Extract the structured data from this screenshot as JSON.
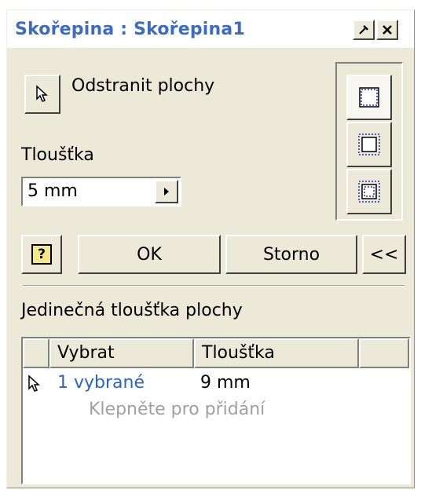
{
  "window": {
    "title": "Skořepina : Skořepina1",
    "buttons": [
      "pin-icon",
      "close-icon"
    ]
  },
  "remove_faces": {
    "label": "Odstranit plochy",
    "icon": "cursor-arrow-icon"
  },
  "thickness": {
    "label": "Tloušťka",
    "value": "5 mm"
  },
  "direction_buttons": [
    "direction-inside-icon",
    "direction-outside-icon",
    "direction-both-icon"
  ],
  "actions": {
    "help": "?",
    "ok": "OK",
    "cancel": "Storno",
    "collapse": "<<"
  },
  "unique_section": {
    "label": "Jedinečná tloušťka plochy",
    "columns": [
      "Vybrat",
      "Tloušťka"
    ],
    "rows": [
      {
        "select": "1 vybrané",
        "thickness": "9 mm"
      }
    ],
    "add_prompt": "Klepněte pro přidání"
  },
  "colors": {
    "title": "#3d6bbf",
    "link": "#2b63c6",
    "muted": "#a0a0a0",
    "face": "#ece9d8"
  }
}
